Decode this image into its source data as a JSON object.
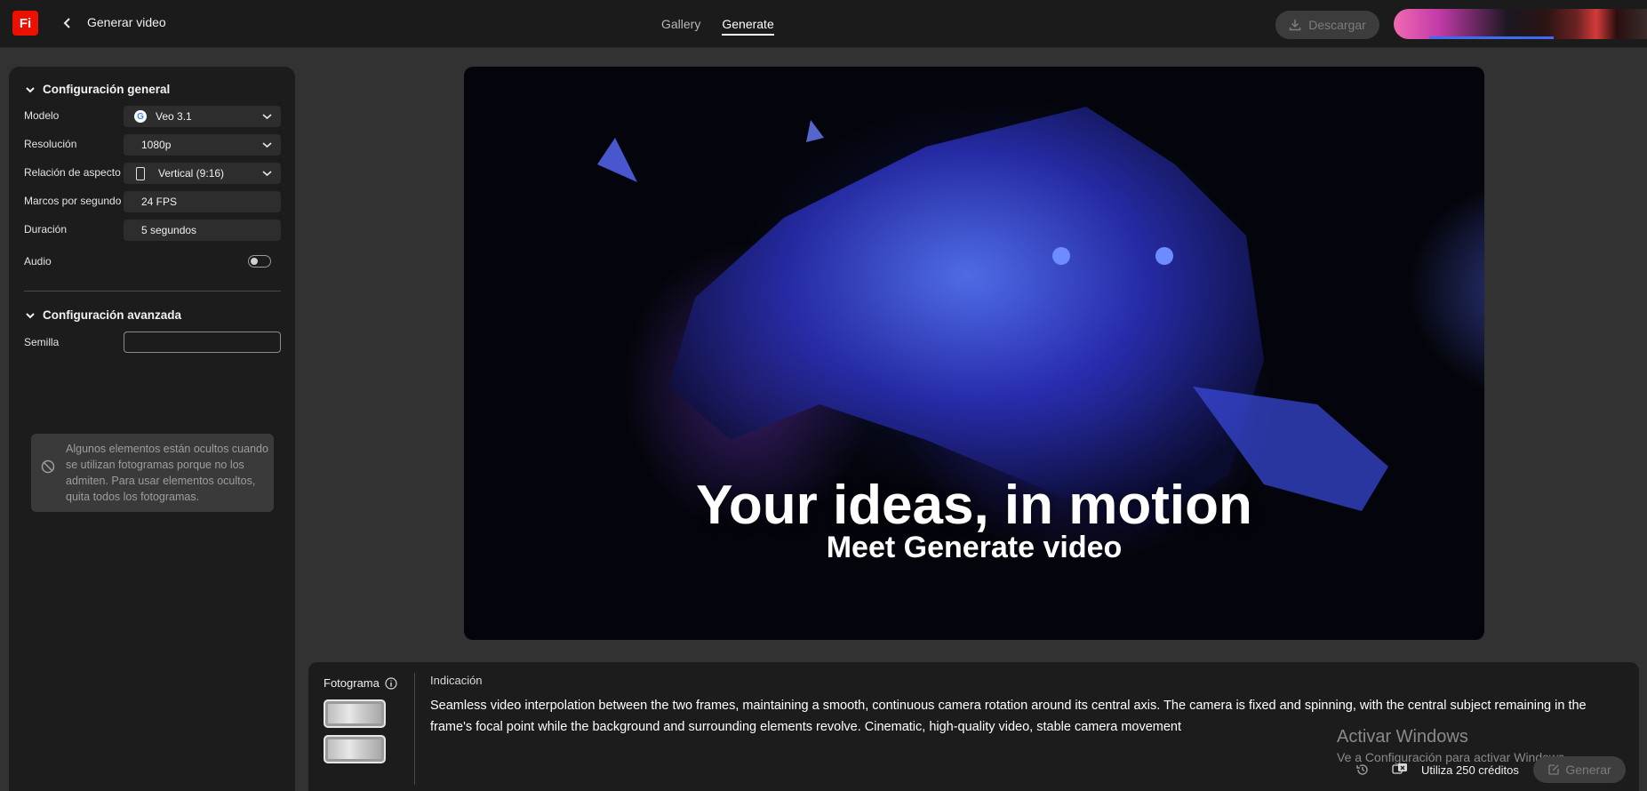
{
  "app": {
    "logo_text": "Fi",
    "brand_color": "#eb1000"
  },
  "header": {
    "back_icon": "chevron-left-icon",
    "title": "Generar video",
    "tabs": [
      {
        "label": "Gallery",
        "active": false
      },
      {
        "label": "Generate",
        "active": true
      }
    ],
    "download_label": "Descargar"
  },
  "settings": {
    "general_title": "Configuración general",
    "rows": {
      "model": {
        "label": "Modelo",
        "value": "Veo 3.1",
        "icon": "google-icon"
      },
      "resolution": {
        "label": "Resolución",
        "value": "1080p"
      },
      "aspect": {
        "label": "Relación de aspecto",
        "value": "Vertical (9:16)",
        "icon": "phone-portrait-icon"
      },
      "fps": {
        "label": "Marcos por segundo",
        "value": "24 FPS"
      },
      "duration": {
        "label": "Duración",
        "value": "5 segundos"
      },
      "audio": {
        "label": "Audio",
        "enabled": false
      }
    },
    "advanced_title": "Configuración avanzada",
    "seed": {
      "label": "Semilla",
      "value": ""
    },
    "notice": "Algunos elementos están ocultos cuando se utilizan fotogramas porque no los admiten. Para usar elementos ocultos, quita todos los fotogramas."
  },
  "preview": {
    "title": "Your ideas, in motion",
    "subtitle": "Meet Generate video"
  },
  "prompt": {
    "frame_label": "Fotograma",
    "label": "Indicación",
    "text": "Seamless video interpolation between the two frames, maintaining a smooth, continuous camera rotation around its central axis. The camera is fixed and spinning, with the central subject remaining in the frame's focal point while the background and surrounding elements revolve. Cinematic, high-quality video, stable camera movement",
    "credits": "Utiliza 250 créditos",
    "generate_label": "Generar"
  },
  "watermark": {
    "title": "Activar Windows",
    "subtitle": "Ve a Configuración para activar Windows."
  }
}
